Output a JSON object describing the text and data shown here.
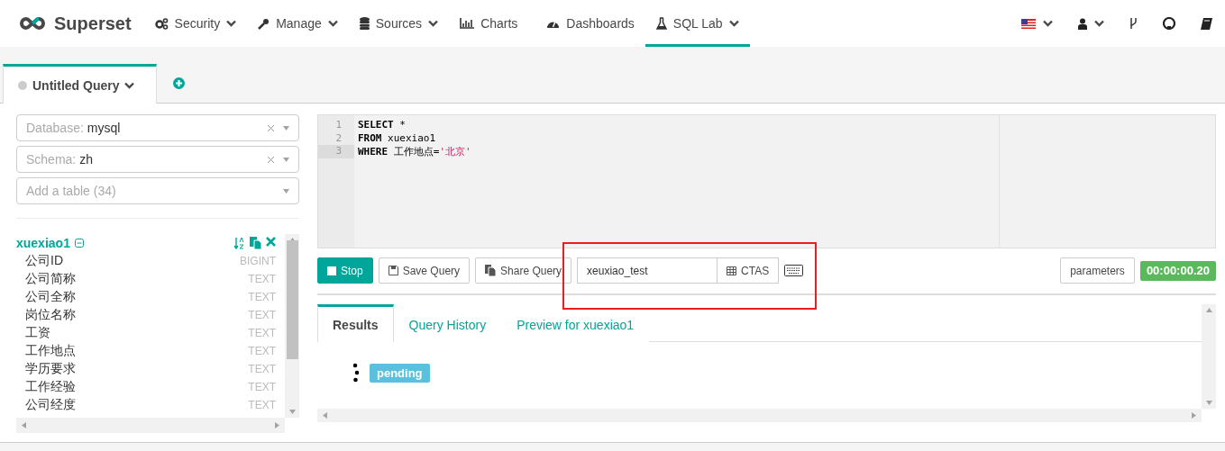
{
  "navbar": {
    "brand": "Superset",
    "items": [
      {
        "label": "Security",
        "kind": "gears",
        "dropdown": true,
        "selected": false
      },
      {
        "label": "Manage",
        "kind": "wrench",
        "dropdown": true,
        "selected": false
      },
      {
        "label": "Sources",
        "kind": "database",
        "dropdown": true,
        "selected": false
      },
      {
        "label": "Charts",
        "kind": "chart",
        "dropdown": false,
        "selected": false
      },
      {
        "label": "Dashboards",
        "kind": "gauge",
        "dropdown": false,
        "selected": false
      },
      {
        "label": "SQL Lab",
        "kind": "flask",
        "dropdown": true,
        "selected": true
      }
    ]
  },
  "query_tabs": [
    {
      "label": "Untitled Query",
      "selected": true
    }
  ],
  "left_panel": {
    "database": {
      "label": "Database:",
      "value": "mysql"
    },
    "schema": {
      "label": "Schema:",
      "value": "zh"
    },
    "table_select": {
      "placeholder": "Add a table (34)"
    },
    "table": {
      "name": "xuexiao1",
      "columns": [
        {
          "name": "公司ID",
          "type": "BIGINT"
        },
        {
          "name": "公司简称",
          "type": "TEXT"
        },
        {
          "name": "公司全称",
          "type": "TEXT"
        },
        {
          "name": "岗位名称",
          "type": "TEXT"
        },
        {
          "name": "工资",
          "type": "TEXT"
        },
        {
          "name": "工作地点",
          "type": "TEXT"
        },
        {
          "name": "学历要求",
          "type": "TEXT"
        },
        {
          "name": "工作经验",
          "type": "TEXT"
        },
        {
          "name": "公司经度",
          "type": "TEXT"
        }
      ]
    }
  },
  "editor": {
    "lines": [
      {
        "number": "1",
        "active": false,
        "tokens": [
          {
            "kind": "keyword",
            "text": "SELECT"
          },
          {
            "kind": "text",
            "text": " *"
          }
        ]
      },
      {
        "number": "2",
        "active": false,
        "tokens": [
          {
            "kind": "keyword",
            "text": "FROM"
          },
          {
            "kind": "text",
            "text": " xuexiao1"
          }
        ]
      },
      {
        "number": "3",
        "active": true,
        "tokens": [
          {
            "kind": "keyword",
            "text": "WHERE"
          },
          {
            "kind": "text",
            "text": " 工作地点="
          },
          {
            "kind": "string",
            "text": "'北京'"
          }
        ]
      }
    ]
  },
  "toolbar": {
    "stop": "Stop",
    "save": "Save Query",
    "share": "Share Query",
    "ctas_value": "xeuxiao_test",
    "ctas": "CTAS",
    "parameters": "parameters",
    "timer": "00:00:00.20"
  },
  "result_tabs": [
    {
      "label": "Results",
      "selected": true
    },
    {
      "label": "Query History",
      "selected": false
    },
    {
      "label": "Preview for xuexiao1",
      "selected": false
    }
  ],
  "status": "pending"
}
